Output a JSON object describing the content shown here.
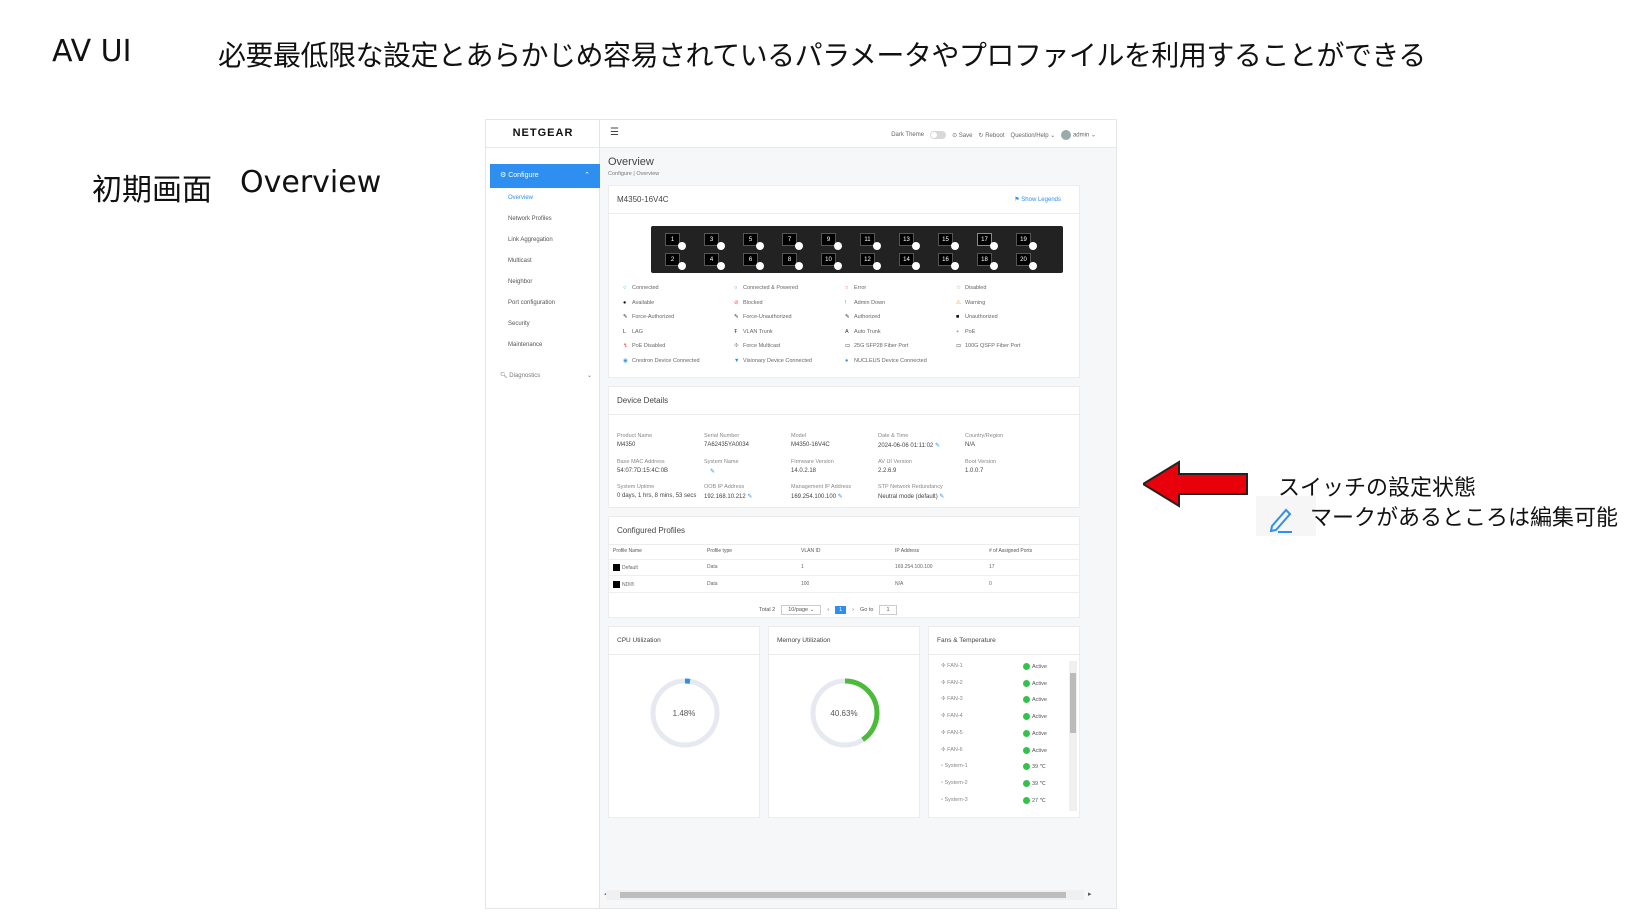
{
  "slide": {
    "title": "AV UI",
    "description": "必要最低限な設定とあらかじめ容易されているパラメータやプロファイルを利用することができる",
    "subtitle_left": "初期画面",
    "subtitle_right": "Overview",
    "callout_line1": "スイッチの設定状態",
    "callout_line2": "マークがあるところは編集可能",
    "arrow_color": "#e8000b"
  },
  "app": {
    "logo": "NETGEAR",
    "accent_color": "#2f8ff0",
    "topbar": {
      "menu_icon": "hamburger-icon",
      "dark_theme": "Dark Theme",
      "save": "Save",
      "reboot": "Reboot",
      "help": "Question/Help",
      "user": "admin"
    },
    "sidebar": {
      "section": "Configure",
      "items": [
        "Overview",
        "Network Profiles",
        "Link Aggregation",
        "Multicast",
        "Neighbor",
        "Port configuration",
        "Security",
        "Maintenance"
      ],
      "diagnostics": "Diagnostics"
    },
    "page_title": "Overview",
    "breadcrumb": "Configure | Overview",
    "device_card": {
      "model": "M4350-16V4C",
      "show_legends": "Show Legends",
      "ports_top": [
        "1",
        "3",
        "5",
        "7",
        "9",
        "11",
        "13",
        "15",
        "17",
        "19"
      ],
      "ports_bottom": [
        "2",
        "4",
        "6",
        "8",
        "10",
        "12",
        "14",
        "16",
        "18",
        "20"
      ],
      "highlight_port": "17",
      "legends": [
        [
          "Connected",
          "Connected & Powered",
          "Error",
          "Disabled"
        ],
        [
          "Available",
          "Blocked",
          "Admin Down",
          "Warning"
        ],
        [
          "Force-Authorized",
          "Force-Unauthorized",
          "Authorized",
          "Unauthorized"
        ],
        [
          "LAG",
          "VLAN Trunk",
          "Auto Trunk",
          "PoE"
        ],
        [
          "PoE Disabled",
          "Force Multicast",
          "25G SFP28 Fiber Port",
          "100G QSFP Fiber Port"
        ],
        [
          "Crestron Device Connected",
          "Visionary Device Connected",
          "NUCLEUS Device Connected",
          ""
        ]
      ]
    },
    "details": {
      "title": "Device Details",
      "fields": [
        {
          "label": "Product Name",
          "value": "M4350"
        },
        {
          "label": "Serial Number",
          "value": "7A62435YA0034"
        },
        {
          "label": "Model",
          "value": "M4350-16V4C"
        },
        {
          "label": "Date & Time",
          "value": "2024-06-06 01:11:02"
        },
        {
          "label": "Country/Region",
          "value": "N/A"
        },
        {
          "label": "Base MAC Address",
          "value": "54:07:7D:15:4C:0B"
        },
        {
          "label": "System Name",
          "value": ""
        },
        {
          "label": "Firmware Version",
          "value": "14.0.2.18"
        },
        {
          "label": "AV UI Version",
          "value": "2.2.6.9"
        },
        {
          "label": "Boot Version",
          "value": "1.0.0.7"
        },
        {
          "label": "System Uptime",
          "value": "0 days, 1 hrs, 8 mins, 53 secs"
        },
        {
          "label": "OOB IP Address",
          "value": "192.168.10.212"
        },
        {
          "label": "Management IP Address",
          "value": "169.254.100.100"
        },
        {
          "label": "STP Network Redundancy",
          "value": "Neutral mode (default)"
        }
      ]
    },
    "profiles": {
      "title": "Configured Profiles",
      "columns": [
        "Profile Name",
        "Profile type",
        "VLAN ID",
        "IP Address",
        "# of Assigned Ports"
      ],
      "rows": [
        [
          "Default",
          "Data",
          "1",
          "169.254.100.100",
          "17"
        ],
        [
          "NDI®",
          "Data",
          "100",
          "N/A",
          "0"
        ]
      ],
      "total": "Total 2",
      "per_page": "10/page",
      "current_page": "1",
      "goto": "Go to",
      "goto_value": "1"
    },
    "cpu": {
      "title": "CPU Utilization",
      "value": "1.48%",
      "percent": 1.48
    },
    "memory": {
      "title": "Memory Utilization",
      "value": "40.63%",
      "percent": 40.63
    },
    "fans": {
      "title": "Fans & Temperature",
      "rows": [
        [
          "FAN-1",
          "Active"
        ],
        [
          "FAN-2",
          "Active"
        ],
        [
          "FAN-3",
          "Active"
        ],
        [
          "FAN-4",
          "Active"
        ],
        [
          "FAN-5",
          "Active"
        ],
        [
          "FAN-6",
          "Active"
        ],
        [
          "System-1",
          "39 ℃"
        ],
        [
          "System-2",
          "39 ℃"
        ],
        [
          "System-3",
          "27 ℃"
        ]
      ]
    }
  }
}
